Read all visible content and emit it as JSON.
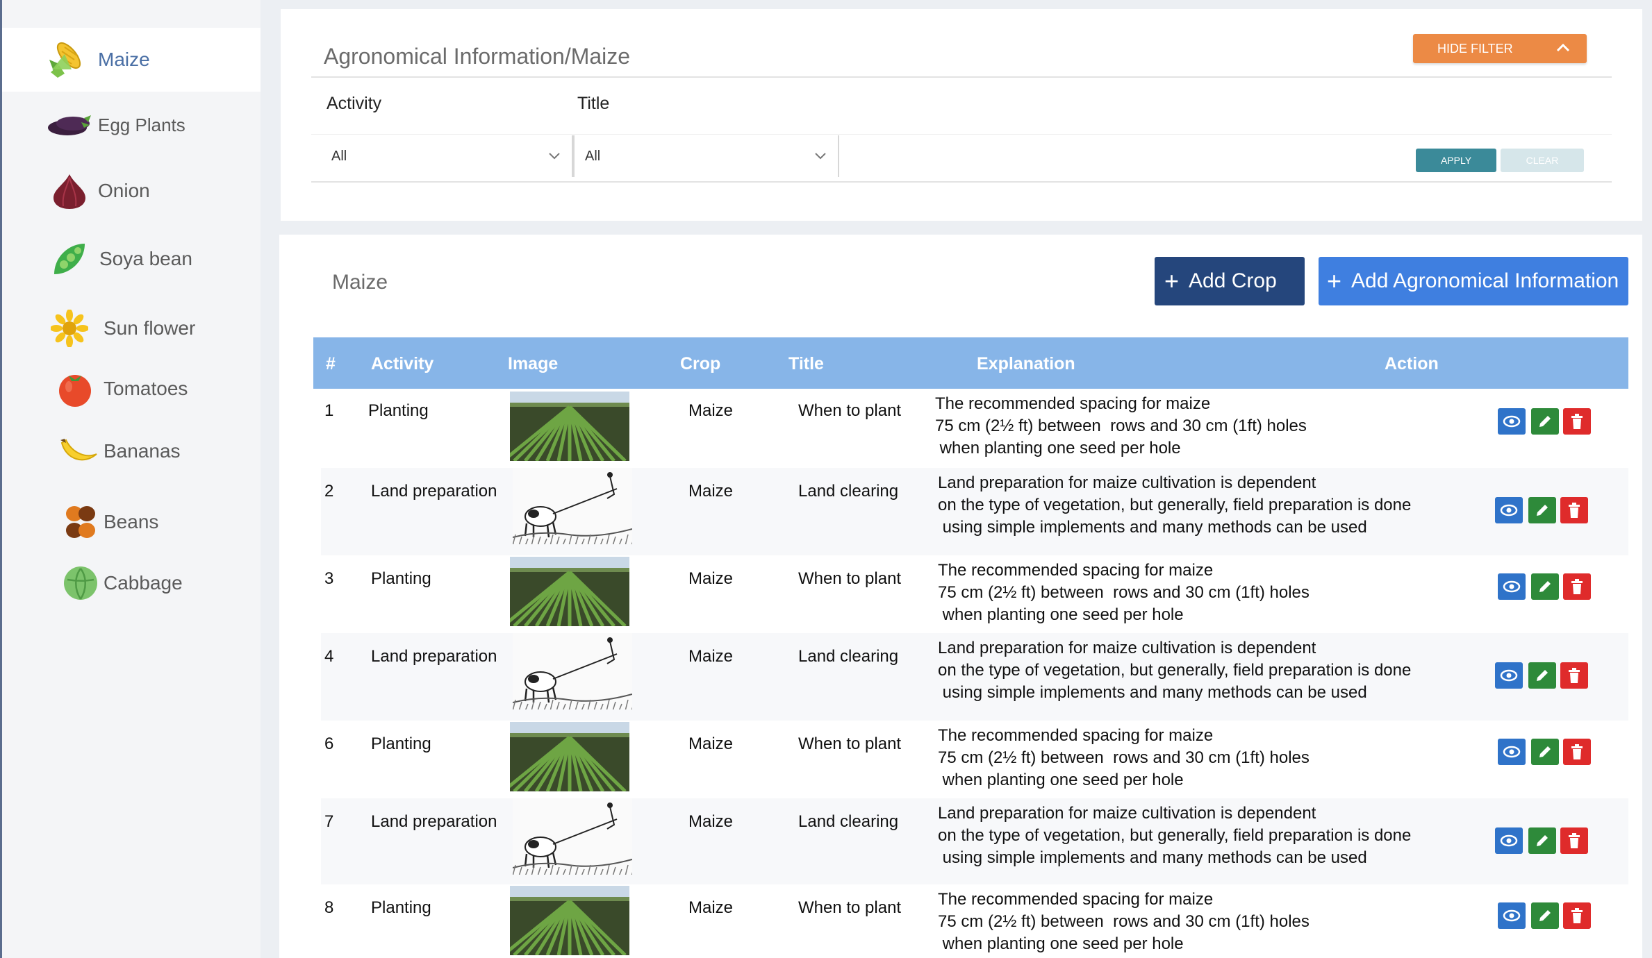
{
  "sidebar": {
    "items": [
      {
        "label": "Maize",
        "icon": "corn-icon",
        "active": true
      },
      {
        "label": "Egg Plants",
        "icon": "eggplant-icon"
      },
      {
        "label": "Onion",
        "icon": "onion-icon"
      },
      {
        "label": "Soya bean",
        "icon": "soybean-icon"
      },
      {
        "label": "Sun flower",
        "icon": "sunflower-icon"
      },
      {
        "label": "Tomatoes",
        "icon": "tomato-icon"
      },
      {
        "label": "Bananas",
        "icon": "banana-icon"
      },
      {
        "label": "Beans",
        "icon": "beans-icon"
      },
      {
        "label": "Cabbage",
        "icon": "cabbage-icon"
      }
    ]
  },
  "filter": {
    "title": "Agronomical Information/Maize",
    "hide_filter_label": "HIDE FILTER",
    "activity_label": "Activity",
    "title_label": "Title",
    "activity_value": "All",
    "title_value": "All",
    "apply_label": "APPLY",
    "clear_label": "CLEAR"
  },
  "list": {
    "title": "Maize",
    "add_crop_label": "Add Crop",
    "add_agro_label": "Add Agronomical Information",
    "columns": [
      "#",
      "Activity",
      "Image",
      "Crop",
      "Title",
      "Explanation",
      "Action"
    ],
    "rows": [
      {
        "num": "1",
        "activity": "Planting",
        "image": "maize-field",
        "crop": "Maize",
        "title": "When to plant",
        "explanation": [
          "The recommended spacing for maize",
          "75 cm (2½ ft) between  rows and 30 cm (1ft) holes",
          " when planting one seed per hole"
        ]
      },
      {
        "num": "2",
        "activity": "Land preparation",
        "image": "ox-plough",
        "crop": "Maize",
        "title": "Land clearing",
        "explanation": [
          "Land preparation for maize cultivation is dependent",
          "on the type of vegetation, but generally, field preparation is done",
          " using simple implements and many methods can be used"
        ]
      },
      {
        "num": "3",
        "activity": "Planting",
        "image": "maize-field",
        "crop": "Maize",
        "title": "When to plant",
        "explanation": [
          "The recommended spacing for maize",
          "75 cm (2½ ft) between  rows and 30 cm (1ft) holes",
          " when planting one seed per hole"
        ]
      },
      {
        "num": "4",
        "activity": "Land preparation",
        "image": "ox-plough",
        "crop": "Maize",
        "title": "Land clearing",
        "explanation": [
          "Land preparation for maize cultivation is dependent",
          "on the type of vegetation, but generally, field preparation is done",
          " using simple implements and many methods can be used"
        ]
      },
      {
        "num": "6",
        "activity": "Planting",
        "image": "maize-field",
        "crop": "Maize",
        "title": "When to plant",
        "explanation": [
          "The recommended spacing for maize",
          "75 cm (2½ ft) between  rows and 30 cm (1ft) holes",
          " when planting one seed per hole"
        ]
      },
      {
        "num": "7",
        "activity": "Land preparation",
        "image": "ox-plough",
        "crop": "Maize",
        "title": "Land clearing",
        "explanation": [
          "Land preparation for maize cultivation is dependent",
          "on the type of vegetation, but generally, field preparation is done",
          " using simple implements and many methods can be used"
        ]
      },
      {
        "num": "8",
        "activity": "Planting",
        "image": "maize-field",
        "crop": "Maize",
        "title": "When to plant",
        "explanation": [
          "The recommended spacing for maize",
          "75 cm (2½ ft) between  rows and 30 cm (1ft) holes",
          " when planting one seed per hole"
        ]
      }
    ]
  },
  "colors": {
    "header_bg": "#87b5e8",
    "hide_filter": "#ec8a45",
    "apply": "#3b8a99",
    "add_crop": "#25467c",
    "add_agro": "#3f7fe0",
    "view": "#2f73c9",
    "edit": "#2e8a3a",
    "delete": "#df2b2b"
  }
}
